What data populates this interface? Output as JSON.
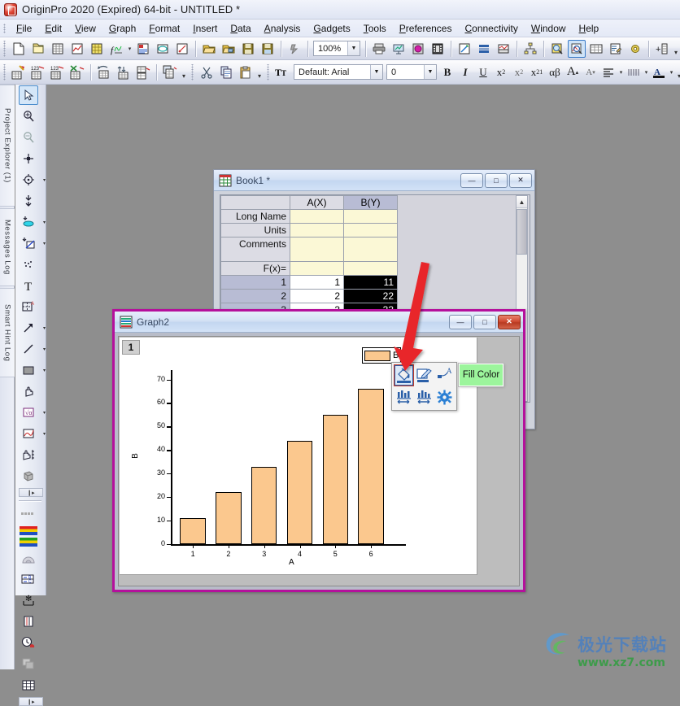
{
  "app": {
    "title": "OriginPro 2020 (Expired) 64-bit - UNTITLED *",
    "icon": "origin-app-icon"
  },
  "menubar": {
    "items": [
      {
        "label": "File",
        "name": "menu-file"
      },
      {
        "label": "Edit",
        "name": "menu-edit"
      },
      {
        "label": "View",
        "name": "menu-view"
      },
      {
        "label": "Graph",
        "name": "menu-graph"
      },
      {
        "label": "Format",
        "name": "menu-format"
      },
      {
        "label": "Insert",
        "name": "menu-insert"
      },
      {
        "label": "Data",
        "name": "menu-data"
      },
      {
        "label": "Analysis",
        "name": "menu-analysis"
      },
      {
        "label": "Gadgets",
        "name": "menu-gadgets"
      },
      {
        "label": "Tools",
        "name": "menu-tools"
      },
      {
        "label": "Preferences",
        "name": "menu-preferences"
      },
      {
        "label": "Connectivity",
        "name": "menu-connectivity"
      },
      {
        "label": "Window",
        "name": "menu-window"
      },
      {
        "label": "Help",
        "name": "menu-help"
      }
    ]
  },
  "toolbar_standard": {
    "zoom_value": "100%",
    "buttons": [
      "new-project-icon",
      "open-project-icon",
      "new-workbook-icon",
      "new-graph-icon",
      "new-matrix-icon",
      "new-function-plot-icon",
      "new-notes-icon",
      "new-layout-icon",
      "new-excel-icon",
      "open-folder-icon",
      "open-template-icon",
      "save-project-icon",
      "save-template-icon",
      "run-script-icon"
    ]
  },
  "toolbar_standard_right": {
    "buttons": [
      "print-icon",
      "presentation-icon",
      "export-image-icon",
      "video-builder-icon",
      "mask-icon",
      "layer-contents-icon",
      "merge-graphs-icon",
      "hierarchy-icon",
      "data-reader-icon",
      "data-selector-icon",
      "worksheet-icon",
      "edit-mode-icon",
      "gear-tools-icon",
      "add-layer-icon"
    ]
  },
  "toolbar_worksheet": {
    "font_value": "Default: Arial",
    "size_value": "0",
    "buttons": [
      "new-column-icon",
      "add-rows-icon",
      "insert-row-icon",
      "delete-icon",
      "transpose-icon",
      "sort-icon",
      "normalize-icon",
      "copy-columns-icon",
      "cut-icon",
      "copy-icon",
      "paste-icon"
    ],
    "format_buttons": [
      {
        "label": "B",
        "name": "bold-button"
      },
      {
        "label": "I",
        "name": "italic-button"
      },
      {
        "label": "U",
        "name": "underline-button"
      },
      {
        "label": "x²",
        "name": "superscript-button"
      },
      {
        "label": "x₂",
        "name": "subscript-button"
      },
      {
        "label": "x²₁",
        "name": "sub-superscript-button"
      },
      {
        "label": "αβ",
        "name": "greek-button"
      },
      {
        "label": "A",
        "name": "increase-font-button"
      },
      {
        "label": "A",
        "name": "decrease-font-button"
      }
    ]
  },
  "left_dock": {
    "tabs": [
      {
        "label": "Project Explorer (1)",
        "name": "dock-project-explorer"
      },
      {
        "label": "Messages Log",
        "name": "dock-messages-log"
      },
      {
        "label": "Smart Hint Log",
        "name": "dock-smart-hint-log"
      }
    ]
  },
  "tool_palette": {
    "tools": [
      {
        "name": "pointer-tool-icon",
        "selected": true
      },
      {
        "name": "zoom-in-tool-icon",
        "selected": false
      },
      {
        "name": "zoom-out-tool-icon",
        "selected": false
      },
      {
        "name": "screen-reader-tool-icon",
        "selected": false
      },
      {
        "name": "data-reader-tool-icon",
        "selected": false
      },
      {
        "name": "data-selector-tool-icon",
        "selected": false
      },
      {
        "name": "regional-mask-tool-icon",
        "selected": false
      },
      {
        "name": "regional-data-tool-icon",
        "selected": false
      },
      {
        "name": "scatter-tool-icon",
        "selected": false
      },
      {
        "name": "text-tool-icon",
        "selected": false
      },
      {
        "name": "annotation-tool-icon",
        "selected": false
      },
      {
        "name": "arrow-tool-icon",
        "selected": false
      },
      {
        "name": "line-tool-icon",
        "selected": false
      },
      {
        "name": "rectangle-tool-icon",
        "selected": false
      },
      {
        "name": "pan-tool-icon",
        "selected": false
      },
      {
        "name": "equation-tool-icon",
        "selected": false
      },
      {
        "name": "curve-tool-icon",
        "selected": false
      },
      {
        "name": "zoom-pan-tool-icon",
        "selected": false
      },
      {
        "name": "3d-rotate-tool-icon",
        "selected": false
      }
    ],
    "tools2": [
      {
        "name": "color-scale-icon",
        "selected": false
      },
      {
        "name": "color-palette-icon",
        "selected": false
      },
      {
        "name": "gradient-icon",
        "selected": false
      },
      {
        "name": "cell-formula-icon",
        "selected": false
      },
      {
        "name": "asterisk-bracket-icon",
        "selected": false
      },
      {
        "name": "axis-scale-icon",
        "selected": false
      },
      {
        "name": "clock-stamp-icon",
        "selected": false
      },
      {
        "name": "duplicate-icon",
        "selected": false
      },
      {
        "name": "grid-icon",
        "selected": false
      }
    ]
  },
  "book1": {
    "title": "Book1 *",
    "icon": "workbook-icon",
    "window_buttons": [
      {
        "label": "—",
        "name": "book1-minimize-button"
      },
      {
        "label": "□",
        "name": "book1-restore-button"
      },
      {
        "label": "✕",
        "name": "book1-close-button"
      }
    ],
    "columns": [
      "",
      "A(X)",
      "B(Y)"
    ],
    "selected_column": "B(Y)",
    "meta_rows": [
      {
        "label": "Long Name",
        "a": "",
        "b": ""
      },
      {
        "label": "Units",
        "a": "",
        "b": ""
      },
      {
        "label": "Comments",
        "a": "",
        "b": ""
      },
      {
        "label": "F(x)=",
        "a": "",
        "b": ""
      }
    ],
    "data_rows": [
      {
        "label": "1",
        "a": "1",
        "b": "11"
      },
      {
        "label": "2",
        "a": "2",
        "b": "22"
      },
      {
        "label": "3",
        "a": "3",
        "b": "33"
      }
    ]
  },
  "graph2": {
    "title": "Graph2",
    "icon": "graph-window-icon",
    "layer_tag": "1",
    "legend_label": "B",
    "window_buttons": [
      {
        "label": "—",
        "name": "graph2-minimize-button"
      },
      {
        "label": "□",
        "name": "graph2-restore-button"
      },
      {
        "label": "✕",
        "name": "graph2-close-button"
      }
    ]
  },
  "mini_toolbar": {
    "tooltip": "Fill Color",
    "buttons": [
      {
        "name": "fill-color-icon",
        "active": true
      },
      {
        "name": "border-color-icon",
        "active": false
      },
      {
        "name": "add-label-icon",
        "active": false
      },
      {
        "name": "bar-gap-icon",
        "active": false
      },
      {
        "name": "bar-offset-icon",
        "active": false
      },
      {
        "name": "plot-properties-icon",
        "active": false
      }
    ]
  },
  "annotation": {
    "arrow_color": "#e8262a",
    "name": "red-pointer-arrow"
  },
  "watermark": {
    "cn_text": "极光下载站",
    "url_text": "www.xz7.com"
  },
  "colors": {
    "bar_fill": "#FBC88E",
    "graph_border": "#b5109c",
    "tooltip_bg": "#9cf59c",
    "workspace_bg": "#8e8e8e",
    "selected_cell_bg": "#000000"
  },
  "chart_data": {
    "type": "bar",
    "title": "",
    "categories": [
      "1",
      "2",
      "3",
      "4",
      "5",
      "6"
    ],
    "values": [
      11,
      22,
      33,
      44,
      55,
      66
    ],
    "series": [
      {
        "name": "B",
        "values": [
          11,
          22,
          33,
          44,
          55,
          66
        ]
      }
    ],
    "xlabel": "A",
    "ylabel": "B",
    "ylim": [
      0,
      74
    ],
    "yticks": [
      0,
      10,
      20,
      30,
      40,
      50,
      60,
      70
    ],
    "xticks": [
      "1",
      "2",
      "3",
      "4",
      "5",
      "6"
    ],
    "grid": false,
    "legend": {
      "position": "top-right",
      "entries": [
        "B"
      ]
    },
    "bar_color": "#FBC88E",
    "bar_border": "#000000"
  }
}
